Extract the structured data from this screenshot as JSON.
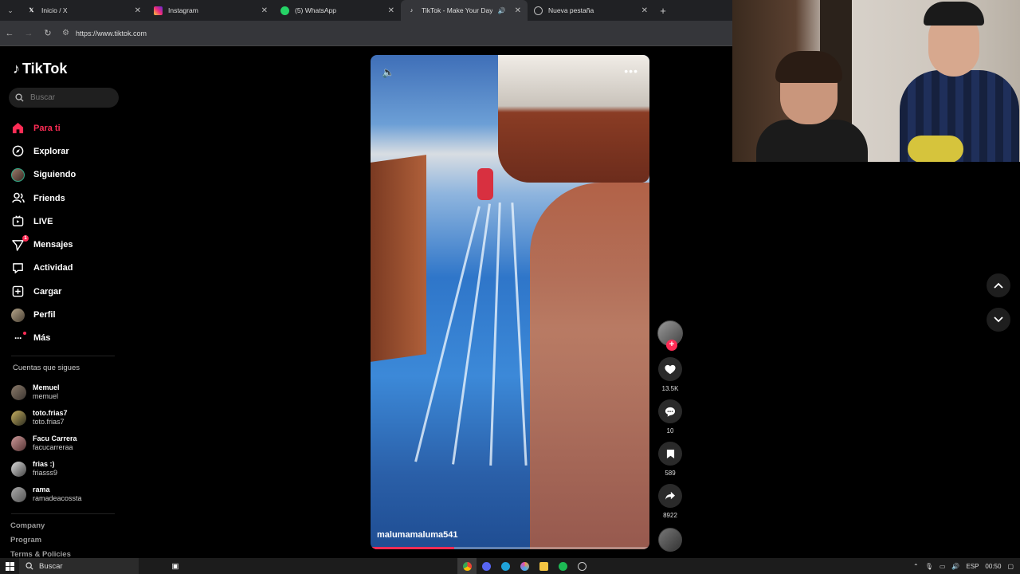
{
  "browser": {
    "tabs": [
      {
        "title": "Inicio / X",
        "icon": "x-logo-icon",
        "active": false
      },
      {
        "title": "Instagram",
        "icon": "instagram-icon",
        "active": false
      },
      {
        "title": "(5) WhatsApp",
        "icon": "whatsapp-icon",
        "active": false
      },
      {
        "title": "TikTok - Make Your Day",
        "icon": "tiktok-icon",
        "active": true
      },
      {
        "title": "Nueva pestaña",
        "icon": "chrome-icon",
        "active": false
      }
    ],
    "url": "https://www.tiktok.com"
  },
  "sidebar": {
    "brand": "TikTok",
    "search_placeholder": "Buscar",
    "nav": [
      {
        "label": "Para ti",
        "icon": "home-icon",
        "active": true
      },
      {
        "label": "Explorar",
        "icon": "compass-icon"
      },
      {
        "label": "Siguiendo",
        "icon": "following-avatar-icon"
      },
      {
        "label": "Friends",
        "icon": "friends-icon"
      },
      {
        "label": "LIVE",
        "icon": "live-icon"
      },
      {
        "label": "Mensajes",
        "icon": "send-icon",
        "badge": "1"
      },
      {
        "label": "Actividad",
        "icon": "activity-icon"
      },
      {
        "label": "Cargar",
        "icon": "upload-icon"
      },
      {
        "label": "Perfil",
        "icon": "profile-avatar-icon"
      },
      {
        "label": "Más",
        "icon": "more-icon",
        "dot": true
      }
    ],
    "following_title": "Cuentas que sigues",
    "following": [
      {
        "name": "Memuel",
        "handle": "memuel"
      },
      {
        "name": "toto.frias7",
        "handle": "toto.frias7"
      },
      {
        "name": "Facu Carrera",
        "handle": "facucarreraa"
      },
      {
        "name": "frias :)",
        "handle": "friasss9"
      },
      {
        "name": "rama",
        "handle": "ramadeacossta"
      }
    ],
    "footer": [
      "Company",
      "Program",
      "Terms & Policies"
    ]
  },
  "video": {
    "author": "malumamaluma541",
    "progress": 0.3
  },
  "actions": {
    "likes": "13.5K",
    "comments": "10",
    "saves": "589",
    "shares": "8922"
  },
  "taskbar": {
    "search": "Buscar",
    "lang": "ESP",
    "time": "00:50"
  },
  "colors": {
    "accent": "#fe2c55",
    "background": "#000000"
  }
}
